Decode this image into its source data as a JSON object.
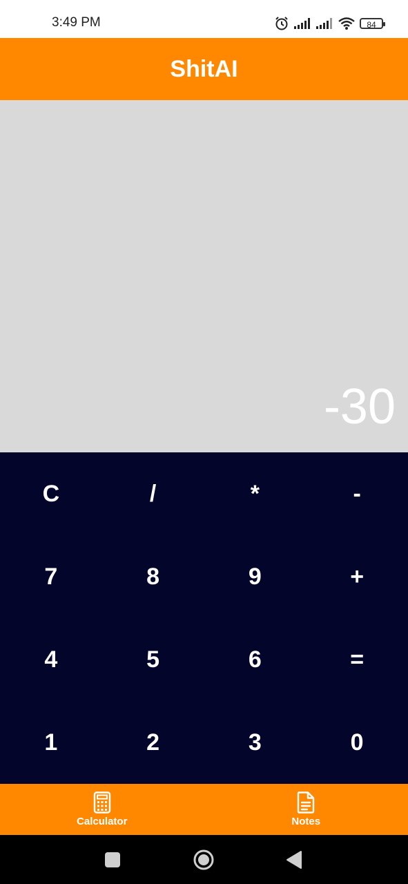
{
  "status_bar": {
    "time": "3:49 PM",
    "battery_level": "84",
    "icons": [
      "alarm-icon",
      "signal-icon",
      "signal-icon",
      "wifi-icon",
      "battery-icon"
    ]
  },
  "app_bar": {
    "title": "ShitAI"
  },
  "display": {
    "value": "-30"
  },
  "keypad": {
    "keys": [
      "C",
      "/",
      "*",
      "-",
      "7",
      "8",
      "9",
      "+",
      "4",
      "5",
      "6",
      "=",
      "1",
      "2",
      "3",
      "0"
    ]
  },
  "bottom_nav": {
    "items": [
      {
        "label": "Calculator",
        "icon": "calculator-icon"
      },
      {
        "label": "Notes",
        "icon": "document-icon"
      }
    ]
  },
  "system_nav": {
    "buttons": [
      "recent-apps-icon",
      "home-icon",
      "back-icon"
    ]
  },
  "colors": {
    "accent": "#ff8800",
    "keypad_bg": "#03062a",
    "display_bg": "#d9d9d9"
  }
}
